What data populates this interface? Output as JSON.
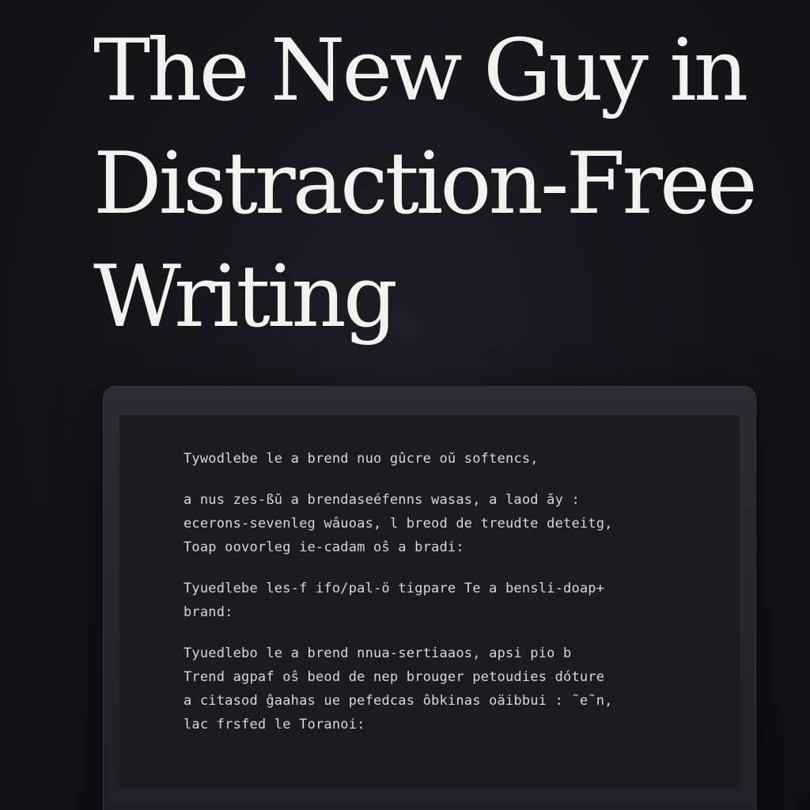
{
  "headline": {
    "line1": "The New Guy in",
    "line2": "Distraction-Free",
    "line3": "Writing"
  },
  "editor": {
    "paragraphs": [
      {
        "lines": [
          "Tywodlebe le a brend nuo gûcre oŭ softencs,"
        ]
      },
      {
        "lines": [
          "a nus zes-ßŭ a brendaseéfenns wasas, a laod ăy :",
          "ecerons-sevenleg wâuoas, l breod de treudte deteitg,",
          "Toap oovorleg ie-cadam oŝ a bradi:"
        ]
      },
      {
        "lines": [
          "Tyuedlebe les-f ifo/pal-ö tigpare Te a bensli-doap+",
          "brand:"
        ]
      },
      {
        "lines": [
          "Tyuedlebo le a brend nnua-sertiaaos, apsi pio b",
          "Trend agpaf oŝ beod de nep brouger petoudies dóture",
          "a citasod ĝaahas ue pefedcas ôbkinas oäibbui : ˜e˜n,",
          "lac frsfed le Toranoi:"
        ]
      }
    ]
  }
}
